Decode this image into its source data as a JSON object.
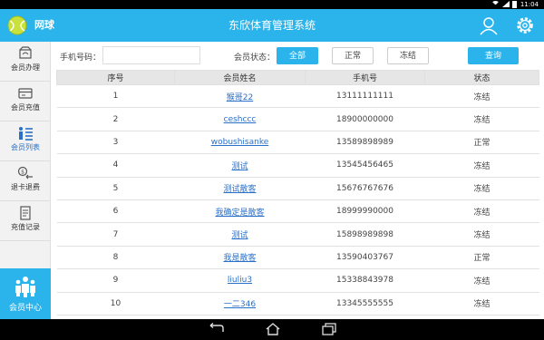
{
  "statusbar": {
    "time": "11:04"
  },
  "header": {
    "sport": "网球",
    "title": "东欣体育管理系统"
  },
  "sidebar": {
    "items": [
      {
        "label": "会员办理",
        "icon": "member-card-icon"
      },
      {
        "label": "会员充值",
        "icon": "wallet-icon"
      },
      {
        "label": "会员列表",
        "icon": "member-list-icon"
      },
      {
        "label": "退卡退费",
        "icon": "refund-icon"
      },
      {
        "label": "充值记录",
        "icon": "record-icon"
      }
    ],
    "center": {
      "label": "会员中心",
      "icon": "group-icon"
    }
  },
  "filter": {
    "phone_label": "手机号码：",
    "phone_value": "",
    "phone_placeholder": "",
    "status_label": "会员状态：",
    "status_buttons": [
      "全部",
      "正常",
      "冻结"
    ],
    "selected_status": "全部",
    "query_label": "查询"
  },
  "table": {
    "columns": [
      "序号",
      "会员姓名",
      "手机号",
      "状态"
    ],
    "rows": [
      [
        "1",
        "猴哥22",
        "13111111111",
        "冻结"
      ],
      [
        "2",
        "ceshccc",
        "18900000000",
        "冻结"
      ],
      [
        "3",
        "wobushisanke",
        "13589898989",
        "正常"
      ],
      [
        "4",
        "测试",
        "13545456465",
        "冻结"
      ],
      [
        "5",
        "测试散客",
        "15676767676",
        "冻结"
      ],
      [
        "6",
        "我确定是散客",
        "18999990000",
        "冻结"
      ],
      [
        "7",
        "测试",
        "15898989898",
        "冻结"
      ],
      [
        "8",
        "我是散客",
        "13590403767",
        "正常"
      ],
      [
        "9",
        "liuliu3",
        "15338843978",
        "冻结"
      ],
      [
        "10",
        "一二346",
        "13345555555",
        "冻结"
      ]
    ]
  },
  "colors": {
    "accent": "#2bb3eb",
    "link": "#2a6fc8",
    "header_row": "#e6e6e6",
    "sidebar_bg": "#f2f2f2"
  }
}
